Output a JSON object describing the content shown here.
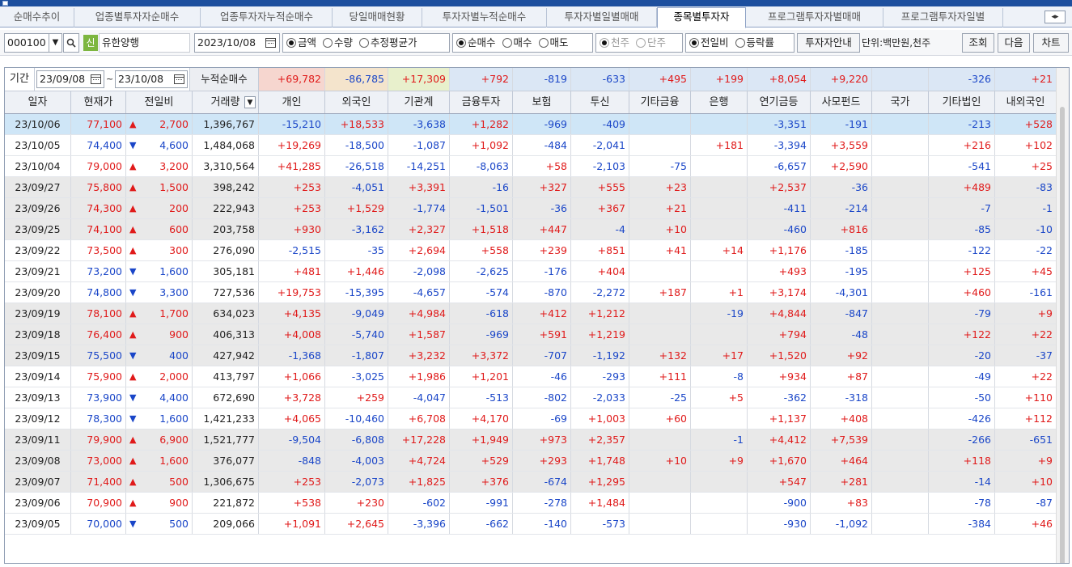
{
  "tabs": [
    "순매수추이",
    "업종별투자자순매수",
    "업종투자자누적순매수",
    "당일매매현황",
    "투자자별누적순매수",
    "투자자별일별매매",
    "종목별투자자",
    "프로그램투자자별매매",
    "프로그램투자자일별"
  ],
  "active_tab": "종목별투자자",
  "toolbar": {
    "code": "000100",
    "badge": "신",
    "stock_name": "유한양행",
    "date": "2023/10/08",
    "opt_amount": "금액",
    "opt_qty": "수량",
    "opt_avg": "추정평균가",
    "opt_net": "순매수",
    "opt_buy": "매수",
    "opt_sell": "매도",
    "opt_1000": "천주",
    "opt_single": "단주",
    "opt_prevday": "전일비",
    "opt_rate": "등락률",
    "guide_btn": "투자자안내",
    "unit": "단위:백만원,천주",
    "query_btn": "조회",
    "next_btn": "다음",
    "chart_btn": "차트"
  },
  "period": {
    "label": "기간",
    "start": "23/09/08",
    "sep": "~",
    "end": "23/10/08",
    "cum_label": "누적순매수"
  },
  "summary": [
    "+69,782",
    "-86,785",
    "+17,309",
    "+792",
    "-819",
    "-633",
    "+495",
    "+199",
    "+8,054",
    "+9,220",
    "",
    "-326",
    "+21"
  ],
  "headers": [
    "일자",
    "현재가",
    "전일비",
    "거래량",
    "개인",
    "외국인",
    "기관계",
    "금융투자",
    "보험",
    "투신",
    "기타금융",
    "은행",
    "연기금등",
    "사모펀드",
    "국가",
    "기타법인",
    "내외국인"
  ],
  "rows": [
    {
      "d": "23/10/06",
      "p": "77,100",
      "dir": "up",
      "chg": "2,700",
      "vol": "1,396,767",
      "v": [
        "-15,210",
        "+18,533",
        "-3,638",
        "+1,282",
        "-969",
        "-409",
        "",
        "",
        "-3,351",
        "-191",
        "",
        "-213",
        "+528"
      ]
    },
    {
      "d": "23/10/05",
      "p": "74,400",
      "dir": "down",
      "chg": "4,600",
      "vol": "1,484,068",
      "v": [
        "+19,269",
        "-18,500",
        "-1,087",
        "+1,092",
        "-484",
        "-2,041",
        "",
        "+181",
        "-3,394",
        "+3,559",
        "",
        "+216",
        "+102"
      ]
    },
    {
      "d": "23/10/04",
      "p": "79,000",
      "dir": "up",
      "chg": "3,200",
      "vol": "3,310,564",
      "v": [
        "+41,285",
        "-26,518",
        "-14,251",
        "-8,063",
        "+58",
        "-2,103",
        "-75",
        "",
        "-6,657",
        "+2,590",
        "",
        "-541",
        "+25"
      ]
    },
    {
      "d": "23/09/27",
      "p": "75,800",
      "dir": "up",
      "chg": "1,500",
      "vol": "398,242",
      "v": [
        "+253",
        "-4,051",
        "+3,391",
        "-16",
        "+327",
        "+555",
        "+23",
        "",
        "+2,537",
        "-36",
        "",
        "+489",
        "-83"
      ]
    },
    {
      "d": "23/09/26",
      "p": "74,300",
      "dir": "up",
      "chg": "200",
      "vol": "222,943",
      "v": [
        "+253",
        "+1,529",
        "-1,774",
        "-1,501",
        "-36",
        "+367",
        "+21",
        "",
        "-411",
        "-214",
        "",
        "-7",
        "-1"
      ]
    },
    {
      "d": "23/09/25",
      "p": "74,100",
      "dir": "up",
      "chg": "600",
      "vol": "203,758",
      "v": [
        "+930",
        "-3,162",
        "+2,327",
        "+1,518",
        "+447",
        "-4",
        "+10",
        "",
        "-460",
        "+816",
        "",
        "-85",
        "-10"
      ]
    },
    {
      "d": "23/09/22",
      "p": "73,500",
      "dir": "up",
      "chg": "300",
      "vol": "276,090",
      "v": [
        "-2,515",
        "-35",
        "+2,694",
        "+558",
        "+239",
        "+851",
        "+41",
        "+14",
        "+1,176",
        "-185",
        "",
        "-122",
        "-22"
      ]
    },
    {
      "d": "23/09/21",
      "p": "73,200",
      "dir": "down",
      "chg": "1,600",
      "vol": "305,181",
      "v": [
        "+481",
        "+1,446",
        "-2,098",
        "-2,625",
        "-176",
        "+404",
        "",
        "",
        "+493",
        "-195",
        "",
        "+125",
        "+45"
      ]
    },
    {
      "d": "23/09/20",
      "p": "74,800",
      "dir": "down",
      "chg": "3,300",
      "vol": "727,536",
      "v": [
        "+19,753",
        "-15,395",
        "-4,657",
        "-574",
        "-870",
        "-2,272",
        "+187",
        "+1",
        "+3,174",
        "-4,301",
        "",
        "+460",
        "-161"
      ]
    },
    {
      "d": "23/09/19",
      "p": "78,100",
      "dir": "up",
      "chg": "1,700",
      "vol": "634,023",
      "v": [
        "+4,135",
        "-9,049",
        "+4,984",
        "-618",
        "+412",
        "+1,212",
        "",
        "-19",
        "+4,844",
        "-847",
        "",
        "-79",
        "+9"
      ]
    },
    {
      "d": "23/09/18",
      "p": "76,400",
      "dir": "up",
      "chg": "900",
      "vol": "406,313",
      "v": [
        "+4,008",
        "-5,740",
        "+1,587",
        "-969",
        "+591",
        "+1,219",
        "",
        "",
        "+794",
        "-48",
        "",
        "+122",
        "+22"
      ]
    },
    {
      "d": "23/09/15",
      "p": "75,500",
      "dir": "down",
      "chg": "400",
      "vol": "427,942",
      "v": [
        "-1,368",
        "-1,807",
        "+3,232",
        "+3,372",
        "-707",
        "-1,192",
        "+132",
        "+17",
        "+1,520",
        "+92",
        "",
        "-20",
        "-37"
      ]
    },
    {
      "d": "23/09/14",
      "p": "75,900",
      "dir": "up",
      "chg": "2,000",
      "vol": "413,797",
      "v": [
        "+1,066",
        "-3,025",
        "+1,986",
        "+1,201",
        "-46",
        "-293",
        "+111",
        "-8",
        "+934",
        "+87",
        "",
        "-49",
        "+22"
      ]
    },
    {
      "d": "23/09/13",
      "p": "73,900",
      "dir": "down",
      "chg": "4,400",
      "vol": "672,690",
      "v": [
        "+3,728",
        "+259",
        "-4,047",
        "-513",
        "-802",
        "-2,033",
        "-25",
        "+5",
        "-362",
        "-318",
        "",
        "-50",
        "+110"
      ]
    },
    {
      "d": "23/09/12",
      "p": "78,300",
      "dir": "down",
      "chg": "1,600",
      "vol": "1,421,233",
      "v": [
        "+4,065",
        "-10,460",
        "+6,708",
        "+4,170",
        "-69",
        "+1,003",
        "+60",
        "",
        "+1,137",
        "+408",
        "",
        "-426",
        "+112"
      ]
    },
    {
      "d": "23/09/11",
      "p": "79,900",
      "dir": "up",
      "chg": "6,900",
      "vol": "1,521,777",
      "v": [
        "-9,504",
        "-6,808",
        "+17,228",
        "+1,949",
        "+973",
        "+2,357",
        "",
        "-1",
        "+4,412",
        "+7,539",
        "",
        "-266",
        "-651"
      ]
    },
    {
      "d": "23/09/08",
      "p": "73,000",
      "dir": "up",
      "chg": "1,600",
      "vol": "376,077",
      "v": [
        "-848",
        "-4,003",
        "+4,724",
        "+529",
        "+293",
        "+1,748",
        "+10",
        "+9",
        "+1,670",
        "+464",
        "",
        "+118",
        "+9"
      ]
    },
    {
      "d": "23/09/07",
      "p": "71,400",
      "dir": "up",
      "chg": "500",
      "vol": "1,306,675",
      "v": [
        "+253",
        "-2,073",
        "+1,825",
        "+376",
        "-674",
        "+1,295",
        "",
        "",
        "+547",
        "+281",
        "",
        "-14",
        "+10"
      ]
    },
    {
      "d": "23/09/06",
      "p": "70,900",
      "dir": "up",
      "chg": "900",
      "vol": "221,872",
      "v": [
        "+538",
        "+230",
        "-602",
        "-991",
        "-278",
        "+1,484",
        "",
        "",
        "-900",
        "+83",
        "",
        "-78",
        "-87"
      ]
    },
    {
      "d": "23/09/05",
      "p": "70,000",
      "dir": "down",
      "chg": "500",
      "vol": "209,066",
      "v": [
        "+1,091",
        "+2,645",
        "-3,396",
        "-662",
        "-140",
        "-573",
        "",
        "",
        "-930",
        "-1,092",
        "",
        "-384",
        "+46"
      ]
    }
  ],
  "row_styles": [
    "sel",
    "white",
    "white",
    "gray",
    "gray",
    "gray",
    "white",
    "white",
    "white",
    "gray",
    "gray",
    "gray",
    "white",
    "white",
    "white",
    "gray",
    "gray",
    "gray",
    "white",
    "white"
  ],
  "colors": {
    "summary_individual": "#f6d6cf",
    "summary_foreign": "#f4e4cc",
    "summary_inst": "#e8f0cc",
    "summary_other": "#dbe7f5",
    "selected_row": "#cfe6f7"
  }
}
